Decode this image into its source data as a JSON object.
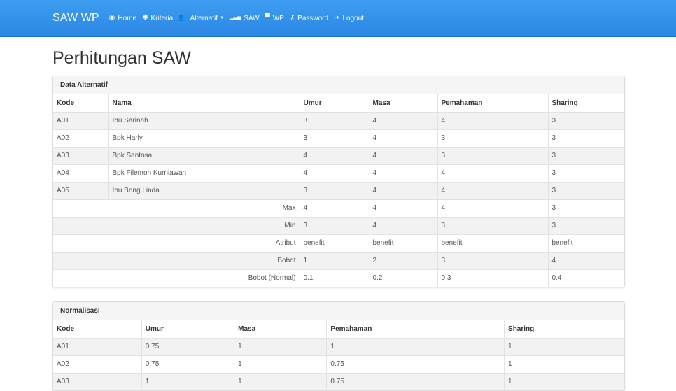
{
  "nav": {
    "brand": "SAW WP",
    "items": [
      {
        "icon": "dashboard-icon",
        "glyph": "◉",
        "label": "Home"
      },
      {
        "icon": "gear-icon",
        "glyph": "✱",
        "label": "Kriteria"
      },
      {
        "icon": "users-icon",
        "glyph": "👥",
        "label": "Alternatif"
      },
      {
        "icon": "signal-icon",
        "glyph": "▂▃▅",
        "label": "SAW"
      },
      {
        "icon": "briefcase-icon",
        "glyph": "▀",
        "label": "WP"
      },
      {
        "icon": "key-icon",
        "glyph": "⚷",
        "label": "Password"
      },
      {
        "icon": "logout-icon",
        "glyph": "⇥",
        "label": "Logout"
      }
    ]
  },
  "page_title": "Perhitungan SAW",
  "alternatif": {
    "heading": "Data Alternatif",
    "headers": [
      "Kode",
      "Nama",
      "Umur",
      "Masa",
      "Pemahaman",
      "Sharing"
    ],
    "rows": [
      [
        "A01",
        "Ibu Sarinah",
        "3",
        "4",
        "4",
        "3"
      ],
      [
        "A02",
        "Bpk Harly",
        "3",
        "4",
        "3",
        "3"
      ],
      [
        "A03",
        "Bpk Santosa",
        "4",
        "4",
        "3",
        "3"
      ],
      [
        "A04",
        "Bpk Filemon Kurniawan",
        "4",
        "4",
        "4",
        "3"
      ],
      [
        "A05",
        "Ibu Bong Linda",
        "3",
        "4",
        "4",
        "3"
      ]
    ],
    "summary": [
      {
        "label": "Max",
        "values": [
          "4",
          "4",
          "4",
          "3"
        ]
      },
      {
        "label": "Min",
        "values": [
          "3",
          "4",
          "3",
          "3"
        ]
      },
      {
        "label": "Atribut",
        "values": [
          "benefit",
          "benefit",
          "benefit",
          "benefit"
        ]
      },
      {
        "label": "Bobot",
        "values": [
          "1",
          "2",
          "3",
          "4"
        ]
      },
      {
        "label": "Bobot (Normal)",
        "values": [
          "0.1",
          "0.2",
          "0.3",
          "0.4"
        ]
      }
    ]
  },
  "normalisasi": {
    "heading": "Normalisasi",
    "headers": [
      "Kode",
      "Umur",
      "Masa",
      "Pemahaman",
      "Sharing"
    ],
    "rows": [
      [
        "A01",
        "0.75",
        "1",
        "1",
        "1"
      ],
      [
        "A02",
        "0.75",
        "1",
        "0.75",
        "1"
      ],
      [
        "A03",
        "1",
        "1",
        "0.75",
        "1"
      ]
    ]
  }
}
